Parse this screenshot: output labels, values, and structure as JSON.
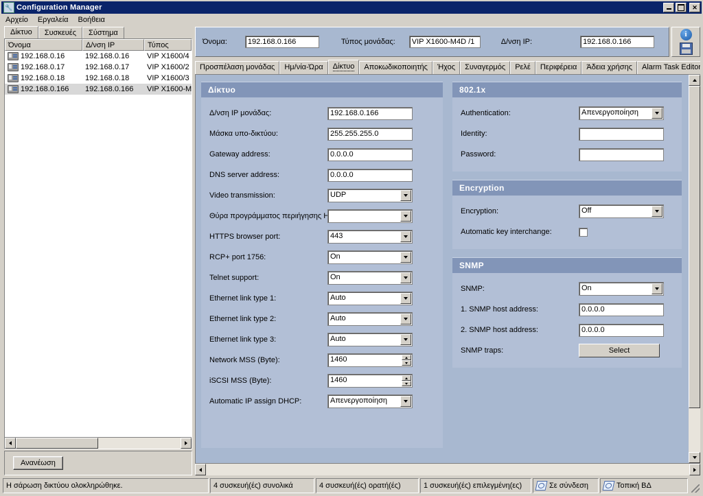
{
  "window": {
    "title": "Configuration Manager",
    "icon": "wrench-icon",
    "minimize_label": "_",
    "maximize_label": "□",
    "close_label": "✕"
  },
  "menubar": {
    "items": [
      {
        "label": "Αρχείο"
      },
      {
        "label": "Εργαλεία"
      },
      {
        "label": "Βοήθεια"
      }
    ]
  },
  "left_pane": {
    "tabs": [
      {
        "label": "Δίκτυο",
        "selected": true
      },
      {
        "label": "Συσκευές",
        "selected": false
      },
      {
        "label": "Σύστημα",
        "selected": false
      }
    ],
    "list": {
      "columns": [
        "Όνομα",
        "Δ/νση IP",
        "Τύπος"
      ],
      "rows": [
        {
          "name": "192.168.0.16",
          "ip": "192.168.0.16",
          "type": "VIP X1600/4",
          "selected": false
        },
        {
          "name": "192.168.0.17",
          "ip": "192.168.0.17",
          "type": "VIP X1600/2",
          "selected": false
        },
        {
          "name": "192.168.0.18",
          "ip": "192.168.0.18",
          "type": "VIP X1600/3",
          "selected": false
        },
        {
          "name": "192.168.0.166",
          "ip": "192.168.0.166",
          "type": "VIP X1600-M",
          "selected": true
        }
      ]
    },
    "refresh_button": "Ανανέωση"
  },
  "header": {
    "name_label": "Όνομα:",
    "name_value": "192.168.0.166",
    "unit_type_label": "Τύπος μονάδας:",
    "unit_type_value": "VIP X1600-M4D /1",
    "ip_label": "Δ/νση IP:",
    "ip_value": "192.168.0.166",
    "info_icon": "info-icon",
    "save_icon": "save-icon"
  },
  "tabs": [
    {
      "label": "Προσπέλαση μονάδας",
      "selected": false
    },
    {
      "label": "Ημ/νία-Ώρα",
      "selected": false
    },
    {
      "label": "Δίκτυο",
      "selected": true
    },
    {
      "label": "Αποκωδικοποιητής",
      "selected": false
    },
    {
      "label": "Ήχος",
      "selected": false
    },
    {
      "label": "Συναγερμός",
      "selected": false
    },
    {
      "label": "Ρελέ",
      "selected": false
    },
    {
      "label": "Περιφέρεια",
      "selected": false
    },
    {
      "label": "Άδεια χρήσης",
      "selected": false
    },
    {
      "label": "Alarm Task Editor",
      "selected": false
    }
  ],
  "network_panel": {
    "title": "Δίκτυο",
    "fields": [
      {
        "label": "Δ/νση IP μονάδας:",
        "type": "text",
        "value": "192.168.0.166"
      },
      {
        "label": "Μάσκα υπο-δικτύου:",
        "type": "text",
        "value": "255.255.255.0"
      },
      {
        "label": "Gateway address:",
        "type": "text",
        "value": "0.0.0.0"
      },
      {
        "label": "DNS server address:",
        "type": "text",
        "value": "0.0.0.0"
      },
      {
        "label": "Video transmission:",
        "type": "combo",
        "value": "UDP"
      },
      {
        "label": "Θύρα προγράμματος περιήγησης HTTP:",
        "type": "combo",
        "value": ""
      },
      {
        "label": "HTTPS browser port:",
        "type": "combo",
        "value": "443"
      },
      {
        "label": "RCP+ port 1756:",
        "type": "combo",
        "value": "On"
      },
      {
        "label": "Telnet support:",
        "type": "combo",
        "value": "On"
      },
      {
        "label": "Ethernet link type 1:",
        "type": "combo",
        "value": "Auto"
      },
      {
        "label": "Ethernet link type 2:",
        "type": "combo",
        "value": "Auto"
      },
      {
        "label": "Ethernet link type 3:",
        "type": "combo",
        "value": "Auto"
      },
      {
        "label": "Network MSS (Byte):",
        "type": "spin",
        "value": "1460"
      },
      {
        "label": "iSCSI MSS (Byte):",
        "type": "spin",
        "value": "1460"
      },
      {
        "label": "Automatic IP assign DHCP:",
        "type": "combo",
        "value": "Απενεργοποίηση"
      }
    ]
  },
  "dot1x_panel": {
    "title": "802.1x",
    "fields": [
      {
        "label": "Authentication:",
        "type": "combo",
        "value": "Απενεργοποίηση"
      },
      {
        "label": "Identity:",
        "type": "text",
        "value": ""
      },
      {
        "label": "Password:",
        "type": "text",
        "value": ""
      }
    ]
  },
  "encryption_panel": {
    "title": "Encryption",
    "fields": [
      {
        "label": "Encryption:",
        "type": "combo",
        "value": "Off"
      },
      {
        "label": "Automatic key interchange:",
        "type": "checkbox",
        "value": "",
        "checked": false
      }
    ]
  },
  "snmp_panel": {
    "title": "SNMP",
    "fields": [
      {
        "label": "SNMP:",
        "type": "combo",
        "value": "On"
      },
      {
        "label": "1. SNMP host address:",
        "type": "text",
        "value": "0.0.0.0"
      },
      {
        "label": "2. SNMP host address:",
        "type": "text",
        "value": "0.0.0.0"
      },
      {
        "label": "SNMP traps:",
        "type": "button",
        "value": "Select"
      }
    ]
  },
  "statusbar": {
    "message": "Η σάρωση δικτύου ολοκληρώθηκε.",
    "total": "4 συσκευή(ές) συνολικά",
    "visible": "4 συσκευή(ές) ορατή(ές)",
    "selected": "1 συσκευή(ές) επιλεγμένη(ες)",
    "connection": "Σε σύνδεση",
    "database": "Τοπική ΒΔ"
  },
  "colors": {
    "titlebar": "#0a246a",
    "panel_header": "#8295b8",
    "panel_body": "#b2bfd6",
    "content_bg": "#a8b8d0",
    "chrome": "#d4d0c8"
  }
}
